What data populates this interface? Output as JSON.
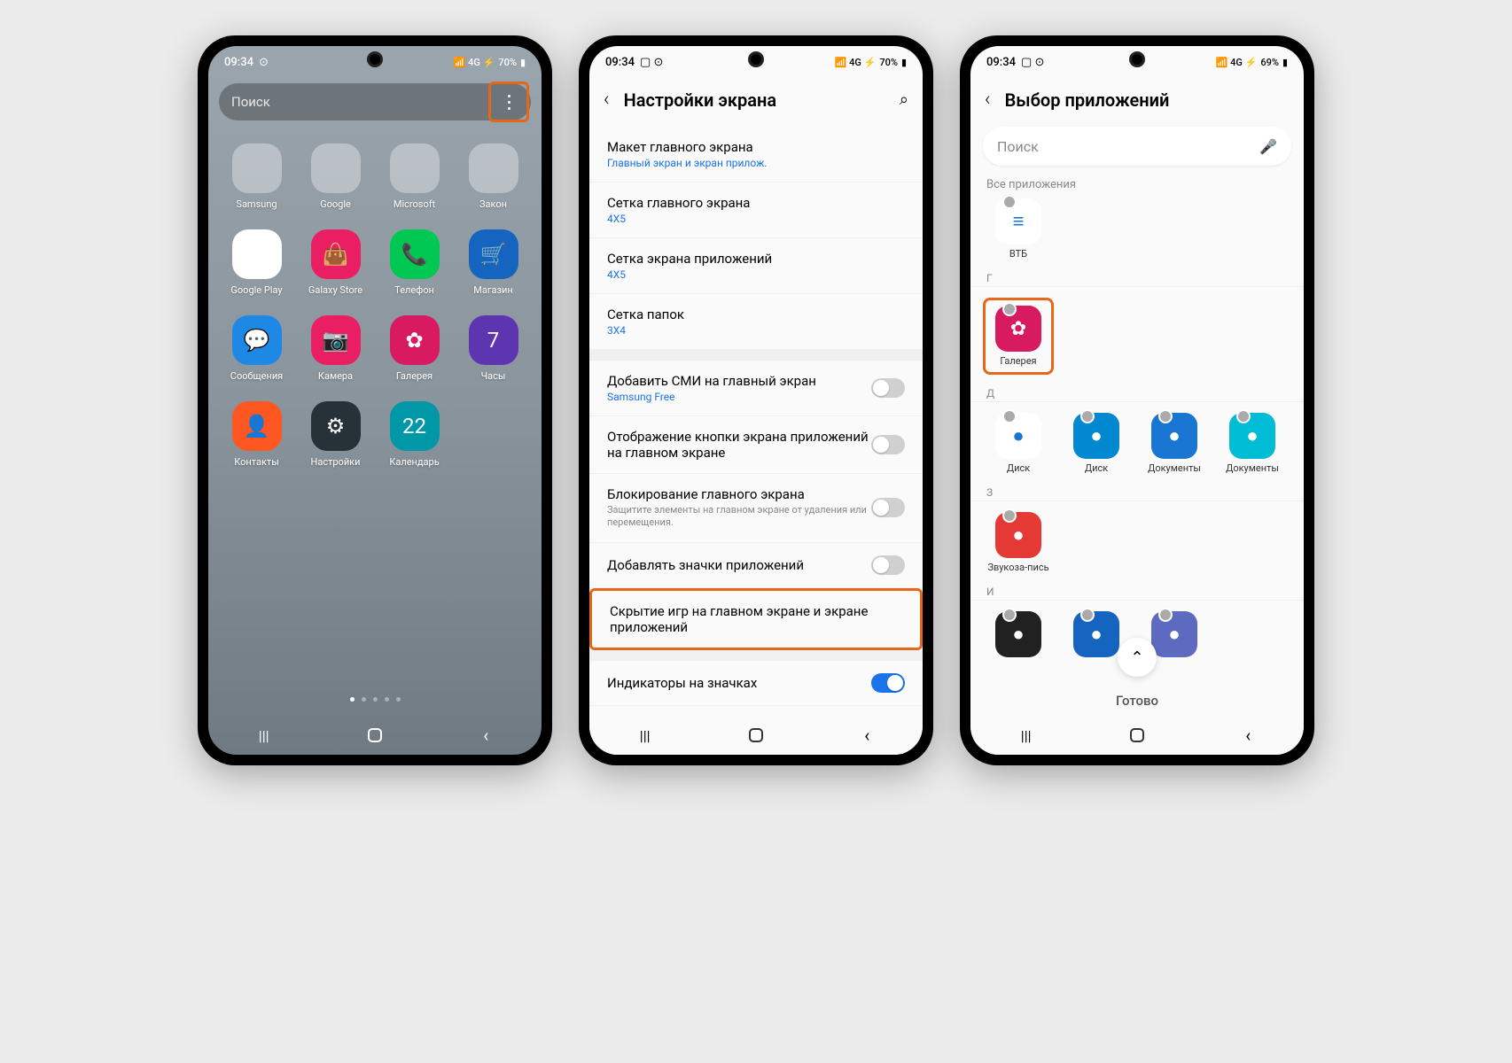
{
  "phone1": {
    "status_time": "09:34",
    "status_battery": "70%",
    "search_placeholder": "Поиск",
    "apps": [
      {
        "label": "Samsung",
        "type": "folder"
      },
      {
        "label": "Google",
        "type": "folder"
      },
      {
        "label": "Microsoft",
        "type": "folder"
      },
      {
        "label": "Закон",
        "type": "folder"
      },
      {
        "label": "Google Play",
        "type": "icon",
        "bg": "#fff"
      },
      {
        "label": "Galaxy Store",
        "type": "icon",
        "bg": "#e91e63"
      },
      {
        "label": "Телефон",
        "type": "icon",
        "bg": "#00c853"
      },
      {
        "label": "Магазин",
        "type": "icon",
        "bg": "#1565c0"
      },
      {
        "label": "Сообщения",
        "type": "icon",
        "bg": "#1e88e5"
      },
      {
        "label": "Камера",
        "type": "icon",
        "bg": "#e91e63"
      },
      {
        "label": "Галерея",
        "type": "icon",
        "bg": "#d81b60"
      },
      {
        "label": "Часы",
        "type": "icon",
        "bg": "#5e35b1"
      },
      {
        "label": "Контакты",
        "type": "icon",
        "bg": "#ff5722"
      },
      {
        "label": "Настройки",
        "type": "icon",
        "bg": "#263238"
      },
      {
        "label": "Календарь",
        "type": "icon",
        "bg": "#0097a7"
      }
    ]
  },
  "phone2": {
    "status_time": "09:34",
    "status_battery": "70%",
    "title": "Настройки экрана",
    "items": [
      {
        "label": "Макет главного экрана",
        "sub": "Главный экран и экран прилож.",
        "sub_type": "blue"
      },
      {
        "label": "Сетка главного экрана",
        "sub": "4X5",
        "sub_type": "blue"
      },
      {
        "label": "Сетка экрана приложений",
        "sub": "4X5",
        "sub_type": "blue"
      },
      {
        "label": "Сетка папок",
        "sub": "3X4",
        "sub_type": "blue"
      }
    ],
    "items2": [
      {
        "label": "Добавить СМИ на главный экран",
        "sub": "Samsung Free",
        "sub_type": "blue",
        "toggle": "off"
      },
      {
        "label": "Отображение кнопки экрана приложений на главном экране",
        "toggle": "off"
      },
      {
        "label": "Блокирование главного экрана",
        "sub": "Защитите элементы на главном экране от удаления или перемещения.",
        "sub_type": "gray",
        "toggle": "off"
      },
      {
        "label": "Добавлять значки приложений",
        "toggle": "off"
      },
      {
        "label": "Скрытие игр на главном экране и экране приложений",
        "highlight": true
      }
    ],
    "items3": [
      {
        "label": "Индикаторы на значках",
        "toggle": "on"
      }
    ]
  },
  "phone3": {
    "status_time": "09:34",
    "status_battery": "69%",
    "title": "Выбор приложений",
    "search_placeholder": "Поиск",
    "all_label": "Все приложения",
    "sections": [
      {
        "letter": "",
        "apps": [
          {
            "label": "ВТБ",
            "bg": "#fff"
          }
        ]
      },
      {
        "letter": "Г",
        "apps": [
          {
            "label": "Галерея",
            "bg": "#d81b60",
            "highlight": true
          }
        ]
      },
      {
        "letter": "Д",
        "apps": [
          {
            "label": "Диск",
            "bg": "#fff"
          },
          {
            "label": "Диск",
            "bg": "#0288d1"
          },
          {
            "label": "Документы",
            "bg": "#1976d2"
          },
          {
            "label": "Документы",
            "bg": "#00bcd4"
          }
        ]
      },
      {
        "letter": "З",
        "apps": [
          {
            "label": "Звукоза-пись",
            "bg": "#e53935"
          }
        ]
      },
      {
        "letter": "И",
        "apps": [
          {
            "label": "",
            "bg": "#212121"
          },
          {
            "label": "",
            "bg": "#1565c0"
          },
          {
            "label": "",
            "bg": "#5c6bc0"
          }
        ]
      }
    ],
    "done_label": "Готово"
  }
}
